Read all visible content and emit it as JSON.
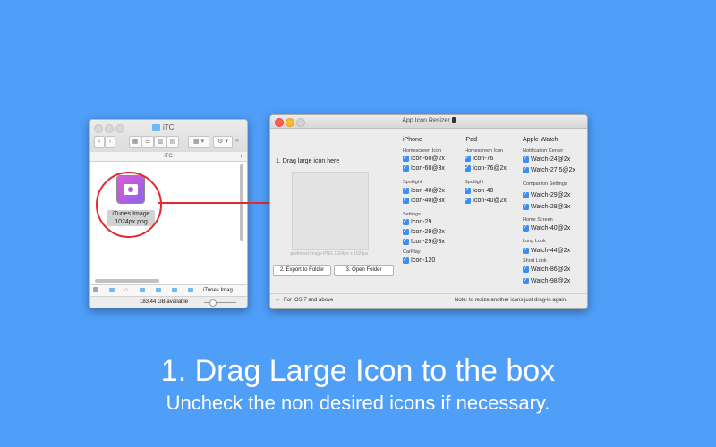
{
  "finder": {
    "title": "iTC",
    "path_header": "iTC",
    "view_buttons": [
      "▦",
      "☰",
      "▥",
      "▤"
    ],
    "file_label_line1": "iTunes Image",
    "file_label_line2": "1024px.png",
    "pathbar_last": "iTunes Imag",
    "status": "183.44 GB available"
  },
  "app": {
    "title": "App Icon Resizer",
    "drag_label": "1. Drag large icon here",
    "preferred_hint": "preferred image PNG 1024px x 1024px",
    "export_button": "2. Export to Folder",
    "open_button": "3. Open Folder",
    "footer_left": "For iOS 7 and above",
    "footer_right": "Note: to resize another icons just drag-in again.",
    "columns": {
      "iphone": {
        "name": "iPhone",
        "homescreen_label": "Homescreen Icon",
        "homescreen": [
          "Icon-60@2x",
          "Icon-60@3x"
        ],
        "spotlight_label": "Spotlight",
        "spotlight": [
          "Icon-40@2x",
          "Icon-40@3x"
        ],
        "settings_label": "Settings",
        "settings": [
          "Icon-29",
          "Icon-29@2x",
          "Icon-29@3x"
        ],
        "carplay_label": "CarPlay",
        "carplay": [
          "Icon-120"
        ]
      },
      "ipad": {
        "name": "iPad",
        "homescreen_label": "Homescreen Icon",
        "homescreen": [
          "Icon-76",
          "Icon-76@2x"
        ],
        "spotlight_label": "Spotlight",
        "spotlight": [
          "Icon-40",
          "Icon-40@2x"
        ]
      },
      "watch": {
        "name": "Apple Watch",
        "notification_label": "Notification Center",
        "notification": [
          "Watch-24@2x",
          "Watch-27.5@2x"
        ],
        "companion_label": "Companion Settings",
        "companion": [
          "Watch-29@2x",
          "Watch-29@3x"
        ],
        "home_label": "Home Screen",
        "home": [
          "Watch-40@2x"
        ],
        "long_look_label": "Long Look",
        "long_look": [
          "Watch-44@2x"
        ],
        "short_look_label": "Short Look",
        "short_look": [
          "Watch-86@2x",
          "Watch-98@2x"
        ]
      }
    }
  },
  "caption": {
    "headline": "1. Drag Large Icon to the box",
    "subline": "Uncheck the non desired icons if necessary."
  },
  "colors": {
    "background": "#4f9ef8",
    "highlight": "#e3282e",
    "checkbox": "#3a8ef6"
  }
}
